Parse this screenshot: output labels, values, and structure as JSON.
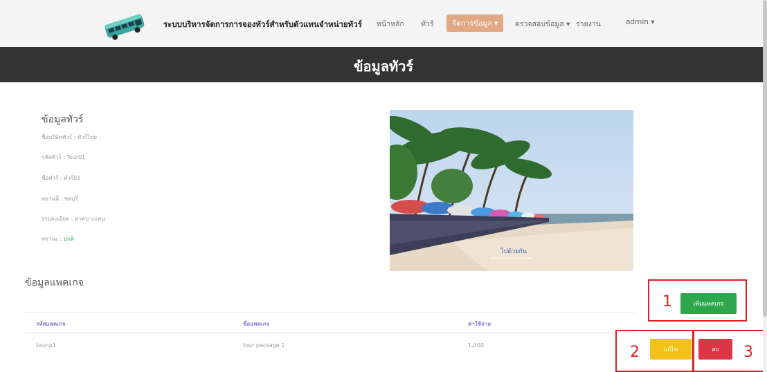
{
  "navbar": {
    "brand": "ระบบบริหารจัดการการจองทัวร์สำหรับตัวแทนจำหน่ายทัวร์",
    "items": [
      {
        "label": "หน้าหลัก"
      },
      {
        "label": "ทัวร์"
      },
      {
        "label": "จัดการข้อมูล ▾"
      },
      {
        "label": "ตรวจสอบข้อมูล ▾"
      },
      {
        "label": "รายงาน"
      },
      {
        "label": "admin ▾"
      }
    ]
  },
  "page_title": "ข้อมูลทัวร์",
  "tour_info": {
    "heading": "ข้อมูลทัวร์",
    "lines": [
      "ชื่อบริษัททัวร์ : ทัวร์ไทย",
      "รหัสทัวร์ : Tour01",
      "ชื่อทัวร์ : ทัวร์01",
      "สถานที่ : ชลบุรี",
      "รายละเอียด : หาดบางแสน"
    ],
    "status_label": "สถานะ : ",
    "status_value": "ปกติ"
  },
  "photo": {
    "watermark_title": "ไปด้วยกัน",
    "watermark_url": "www.paiduaykan.com"
  },
  "packages": {
    "heading": "ข้อมูลแพคเกจ",
    "columns": [
      "รหัสแพคเกจ",
      "ชื่อแพคเกจ",
      "ค่าใช้จ่าย"
    ],
    "rows": [
      {
        "code": "tour-p1",
        "name": "tour package 1",
        "price": "1,000"
      }
    ],
    "add_label": "เพิ่มแพคเกจ",
    "edit_label": "แก้ไข",
    "delete_label": "ลบ"
  },
  "annotations": [
    "1",
    "2",
    "3"
  ],
  "colors": {
    "accent": "#e0a884",
    "add": "#2ea64b",
    "edit": "#f2c21a",
    "delete": "#dc3545",
    "annotation": "#e02020",
    "status_ok": "#35b05a"
  }
}
